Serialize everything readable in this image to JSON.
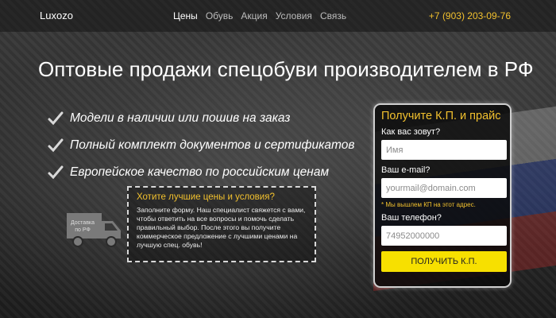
{
  "header": {
    "logo": "Luxozo",
    "nav": [
      "Цены",
      "Обувь",
      "Акция",
      "Условия",
      "Связь"
    ],
    "phone": "+7 (903) 203-09-76"
  },
  "hero": {
    "headline": "Оптовые продажи спецобуви производителем в РФ",
    "features": [
      "Модели в наличии или пошив на заказ",
      "Полный комплект документов и сертификатов",
      "Европейское качество по российским ценам"
    ]
  },
  "truck": {
    "label": "Доставка по РФ"
  },
  "infobox": {
    "title": "Хотите лучшие цены и условия?",
    "text": "Заполните форму. Наш специалист свяжется с вами, чтобы ответить на все вопросы и помочь сделать правильный выбор. После этого вы получите коммерческое предложение с лучшими ценами на лучшую спец. обувь!"
  },
  "form": {
    "title": "Получите К.П. и прайс",
    "name_label": "Как вас зовут?",
    "name_placeholder": "Имя",
    "email_label": "Ваш e-mail?",
    "email_placeholder": "yourmail@domain.com",
    "note": "* Мы вышлем КП на этот адрес.",
    "phone_label": "Ваш телефон?",
    "phone_placeholder": "74952000000",
    "submit": "ПОЛУЧИТЬ К.П."
  },
  "colors": {
    "accent": "#f2c12e",
    "button": "#f7e000"
  }
}
